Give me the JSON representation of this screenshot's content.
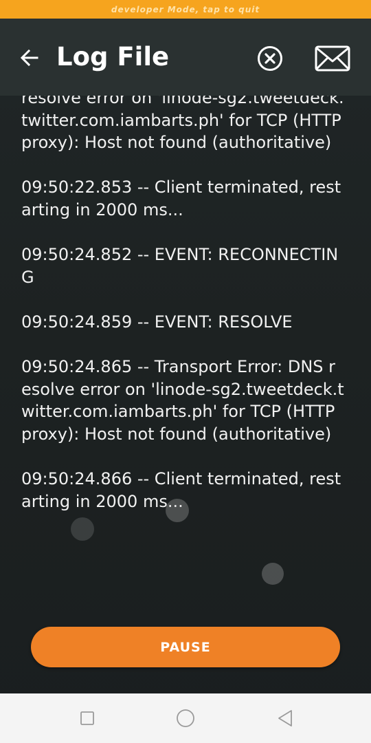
{
  "banner": {
    "text": "developer Mode, tap to quit"
  },
  "app_bar": {
    "title": "Log File",
    "back_icon": "arrow-left-icon",
    "clear_icon": "circle-x-icon",
    "mail_icon": "envelope-icon"
  },
  "log": {
    "entries": [
      "resolve error on 'linode-sg2.tweetdeck.twitter.com.iambarts.ph' for TCP (HTTP proxy): Host not found (authoritative)",
      "09:50:22.853 -- Client terminated, restarting in 2000 ms...",
      "09:50:24.852 -- EVENT: RECONNECTING",
      "09:50:24.859 -- EVENT: RESOLVE",
      "09:50:24.865 -- Transport Error: DNS resolve error on 'linode-sg2.tweetdeck.twitter.com.iambarts.ph' for TCP (HTTP proxy): Host not found (authoritative)",
      "09:50:24.866 -- Client terminated, restarting in 2000 ms..."
    ]
  },
  "actions": {
    "pause_label": "PAUSE"
  },
  "nav": {
    "recents_icon": "square-icon",
    "home_icon": "circle-icon",
    "back_icon": "triangle-back-icon"
  },
  "colors": {
    "banner": "#f6a41e",
    "app_bar": "#2a3131",
    "background": "#1d2222",
    "accent": "#ef8126",
    "text": "#f1f1f1"
  }
}
